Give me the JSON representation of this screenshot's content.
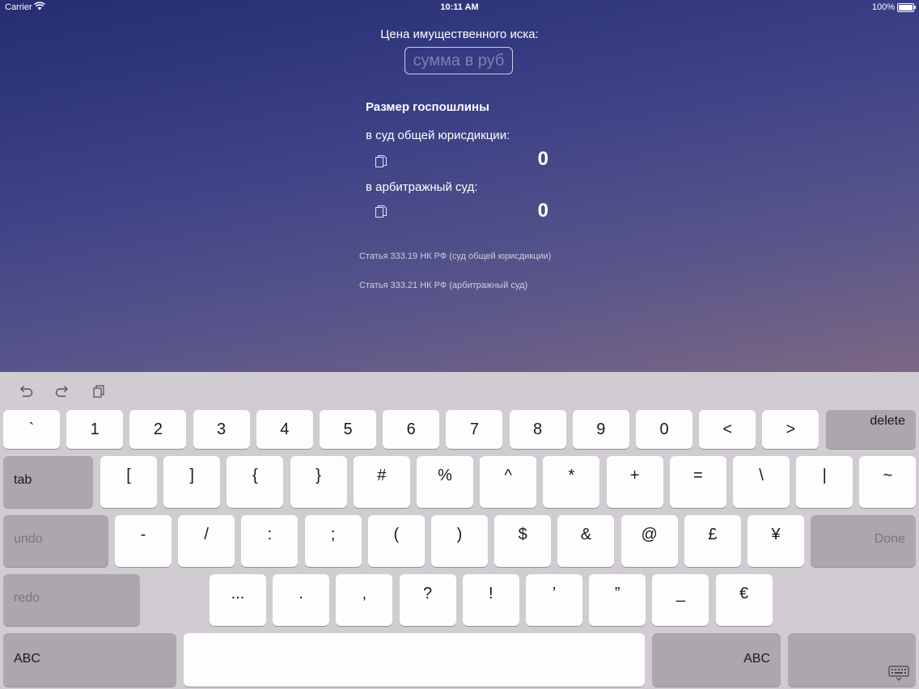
{
  "status_bar": {
    "carrier": "Carrier",
    "time": "10:11 AM",
    "battery": "100%"
  },
  "form": {
    "claim_label": "Цена имущественного иска:",
    "sum_placeholder": "сумма в руб",
    "fee_heading": "Размер госпошлины",
    "general_court_label": "в суд общей юрисдикции:",
    "general_court_value": "0",
    "arbitration_court_label": "в арбитражный суд:",
    "arbitration_court_value": "0",
    "article_general": "Статья 333.19 НК РФ (суд общей юрисдикции)",
    "article_arbitration": "Статья 333.21 НК РФ (арбитражный суд)"
  },
  "keyboard": {
    "toolbar_icons": [
      "undo-arrow-icon",
      "redo-arrow-icon",
      "paste-icon"
    ],
    "row1": [
      "`",
      "1",
      "2",
      "3",
      "4",
      "5",
      "6",
      "7",
      "8",
      "9",
      "0",
      "<",
      ">"
    ],
    "delete_label": "delete",
    "tab_label": "tab",
    "row2": [
      "[",
      "]",
      "{",
      "}",
      "#",
      "%",
      "^",
      "*",
      "+",
      "=",
      "\\",
      "|",
      "~"
    ],
    "undo_label": "undo",
    "row3": [
      "-",
      "/",
      ":",
      ";",
      "(",
      ")",
      "$",
      "&",
      "@",
      "£",
      "¥"
    ],
    "done_label": "Done",
    "redo_label": "redo",
    "row4": [
      "...",
      ".",
      ",",
      "?",
      "!",
      "’",
      "”",
      "_",
      "€"
    ],
    "abc_label": "ABC",
    "dismiss_icon": "keyboard-dismiss-icon"
  }
}
